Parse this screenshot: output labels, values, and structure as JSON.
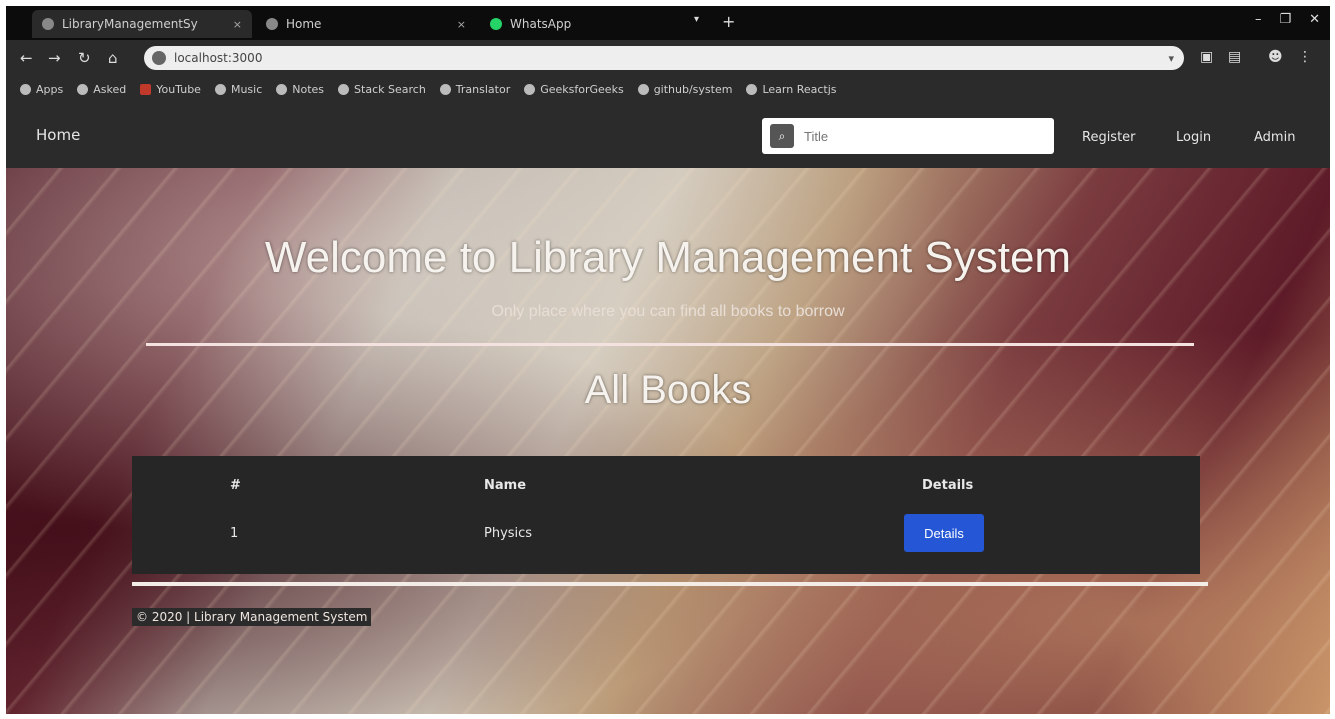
{
  "browser": {
    "tabs": [
      {
        "title": "LibraryManagementSy",
        "close": "×"
      },
      {
        "title": "Home",
        "close": "×"
      },
      {
        "title": "WhatsApp",
        "close": "×"
      }
    ],
    "new_tab": "+",
    "tab_dropdown": "▾",
    "window_controls": [
      "–",
      "❐",
      "✕"
    ],
    "nav": {
      "back": "←",
      "forward": "→",
      "reload": "↻",
      "home": "⌂"
    },
    "url": "localhost:3000",
    "bookmarks": [
      "Apps",
      "Asked",
      "YouTube",
      "Music",
      "Notes",
      "Stack Search",
      "Translator",
      "GeeksforGeeks",
      "github/system",
      "Learn Reactjs"
    ]
  },
  "navbar": {
    "brand": "Home",
    "search_placeholder": "Title",
    "links": [
      "Register",
      "Login",
      "Admin"
    ]
  },
  "hero": {
    "title": "Welcome to Library Management System",
    "subtitle": "Only place where you can find all books to borrow"
  },
  "books": {
    "heading": "All Books",
    "columns": [
      "#",
      "Name",
      "Details"
    ],
    "rows": [
      {
        "num": "1",
        "name": "Physics",
        "action": "Details"
      }
    ]
  },
  "footer": {
    "text": "© 2020 | Library Management System"
  }
}
